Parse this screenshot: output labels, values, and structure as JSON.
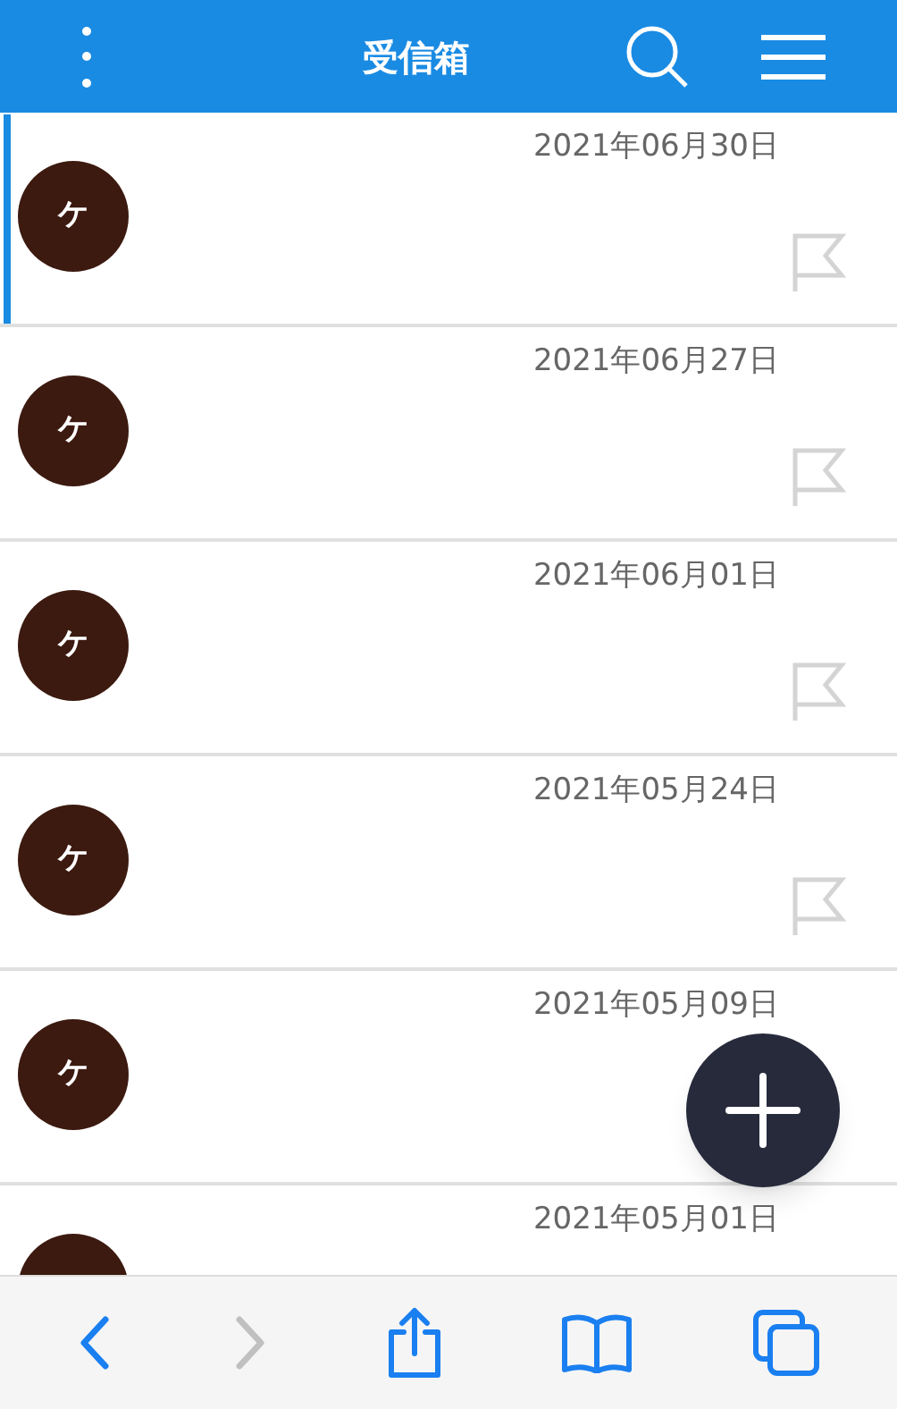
{
  "header": {
    "title": "受信箱"
  },
  "messages": [
    {
      "avatar": "ケ",
      "date": "2021年06月30日",
      "selected": true,
      "flag": true
    },
    {
      "avatar": "ケ",
      "date": "2021年06月27日",
      "selected": false,
      "flag": true
    },
    {
      "avatar": "ケ",
      "date": "2021年06月01日",
      "selected": false,
      "flag": true
    },
    {
      "avatar": "ケ",
      "date": "2021年05月24日",
      "selected": false,
      "flag": true
    },
    {
      "avatar": "ケ",
      "date": "2021年05月09日",
      "selected": false,
      "flag": false
    },
    {
      "date": "2021年05月01日",
      "selected": false,
      "flag": false
    }
  ],
  "browser_toolbar": {
    "back": {
      "disabled": false
    },
    "forward": {
      "disabled": true
    }
  }
}
